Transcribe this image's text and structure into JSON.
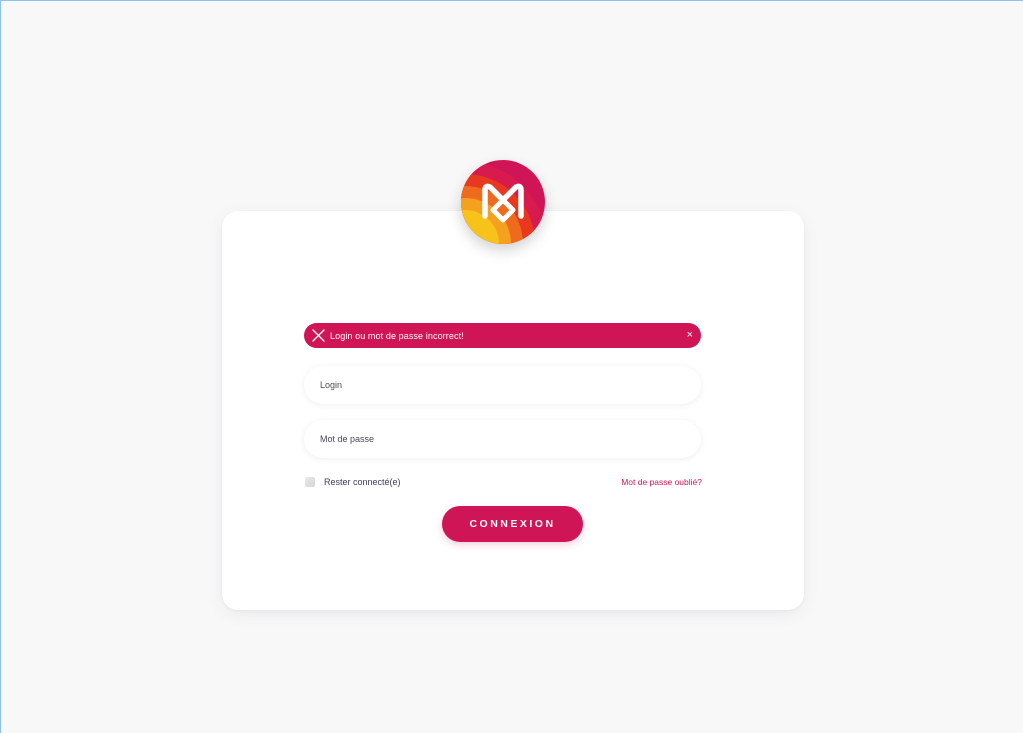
{
  "brand": {
    "logo_icon": "m-heart-logo",
    "colors": {
      "primary": "#cf1556",
      "logo_layers": [
        "#f7c31b",
        "#f5a01e",
        "#ee6a1f",
        "#e8381f",
        "#d91a4e",
        "#cf1556"
      ]
    }
  },
  "alert": {
    "icon": "close-x-icon",
    "message": "Login ou mot de passe incorrect!",
    "dismiss_label": "×"
  },
  "form": {
    "login_placeholder": "Login",
    "password_placeholder": "Mot de passe",
    "remember_label": "Rester connecté(e)",
    "forgot_link": "Mot de passe oublié?",
    "submit_label": "CONNEXION"
  }
}
